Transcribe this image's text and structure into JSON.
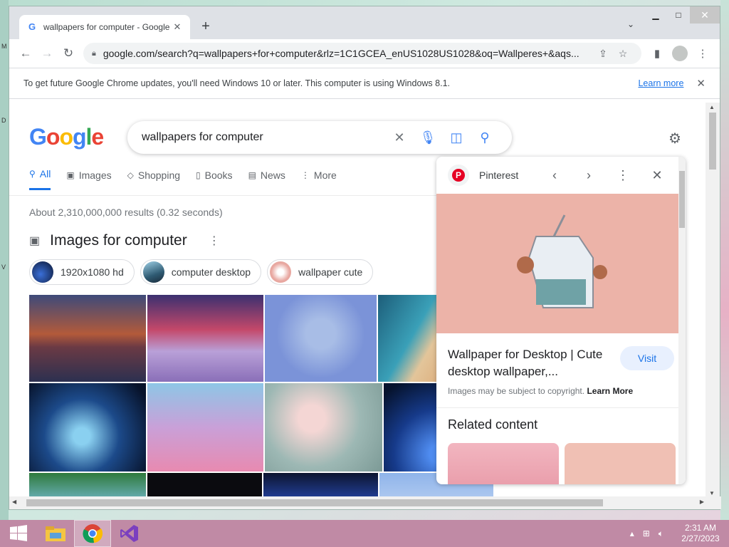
{
  "browser": {
    "tab_title": "wallpapers for computer - Google Search",
    "tab_favicon": "G",
    "url": "google.com/search?q=wallpapers+for+computer&rlz=1C1GCEA_enUS1028US1028&oq=Wallperes+&aqs...",
    "infobar_message": "To get future Google Chrome updates, you'll need Windows 10 or later. This computer is using Windows 8.1.",
    "infobar_link": "Learn more"
  },
  "search": {
    "query": "wallpapers for computer",
    "tabs": [
      {
        "label": "All",
        "icon": "search-icon"
      },
      {
        "label": "Images",
        "icon": "image-icon"
      },
      {
        "label": "Shopping",
        "icon": "tag-icon"
      },
      {
        "label": "Books",
        "icon": "book-icon"
      },
      {
        "label": "News",
        "icon": "news-icon"
      },
      {
        "label": "More",
        "icon": "more-vert-icon"
      }
    ],
    "stats": "About 2,310,000,000 results (0.32 seconds)",
    "section_title": "Images for computer",
    "chips": [
      "1920x1080 hd",
      "computer desktop",
      "wallpaper cute"
    ]
  },
  "panel": {
    "source": "Pinterest",
    "title": "Wallpaper for Desktop | Cute desktop wallpaper,...",
    "visit_label": "Visit",
    "copyright": "Images may be subject to copyright.",
    "learn_more": "Learn More",
    "related_label": "Related content"
  },
  "taskbar": {
    "time": "2:31 AM",
    "date": "2/27/2023"
  },
  "colors": {
    "accent": "#1a73e8",
    "taskbar": "#c08aa5"
  }
}
